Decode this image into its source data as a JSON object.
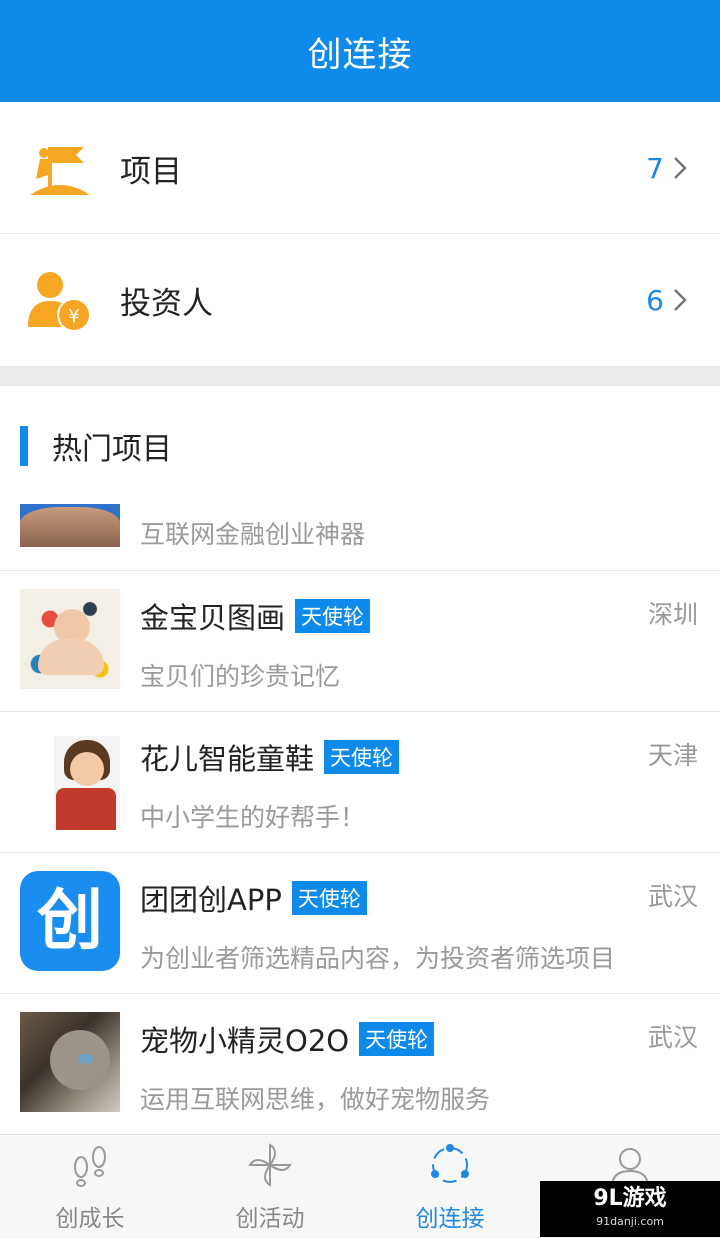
{
  "header": {
    "title": "创连接"
  },
  "menu": [
    {
      "label": "项目",
      "count": "7",
      "icon": "flag-on-mountain-icon"
    },
    {
      "label": "投资人",
      "count": "6",
      "icon": "investor-person-yen-icon"
    }
  ],
  "section": {
    "title": "热门项目"
  },
  "projects": [
    {
      "name": "",
      "badge": "",
      "city": "",
      "desc": "互联网金融创业神器"
    },
    {
      "name": "金宝贝图画",
      "badge": "天使轮",
      "city": "深圳",
      "desc": "宝贝们的珍贵记忆"
    },
    {
      "name": "花儿智能童鞋",
      "badge": "天使轮",
      "city": "天津",
      "desc": "中小学生的好帮手！"
    },
    {
      "name": "团团创APP",
      "badge": "天使轮",
      "city": "武汉",
      "desc": "为创业者筛选精品内容，为投资者筛选项目",
      "logo_text": "创"
    },
    {
      "name": "宠物小精灵O2O",
      "badge": "天使轮",
      "city": "武汉",
      "desc": "运用互联网思维，做好宠物服务"
    }
  ],
  "tabs": [
    {
      "label": "创成长",
      "icon": "footprints-icon",
      "active": false
    },
    {
      "label": "创活动",
      "icon": "pinwheel-icon",
      "active": false
    },
    {
      "label": "创连接",
      "icon": "connect-nodes-icon",
      "active": true
    },
    {
      "label": "",
      "icon": "user-icon",
      "active": false
    }
  ],
  "watermark": {
    "brand": "9L游戏",
    "url": "91danji.com"
  },
  "colors": {
    "primary": "#0e8bea",
    "accent_orange": "#f5a623"
  }
}
